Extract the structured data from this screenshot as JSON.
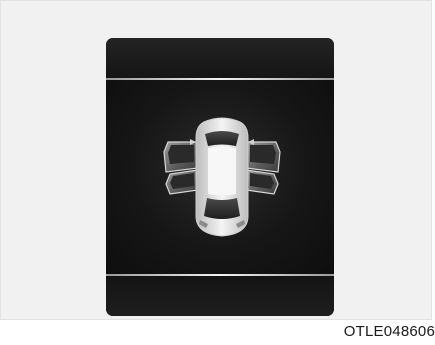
{
  "figure": {
    "image_code": "OTLE048606"
  },
  "display": {
    "icon": "car-doors-open-icon",
    "open_doors": [
      "front-left",
      "front-right",
      "rear-left",
      "rear-right"
    ],
    "colors": {
      "screen_background": "#141414",
      "divider": "#f2f2f2",
      "car_body": "#e9e9e9"
    }
  }
}
